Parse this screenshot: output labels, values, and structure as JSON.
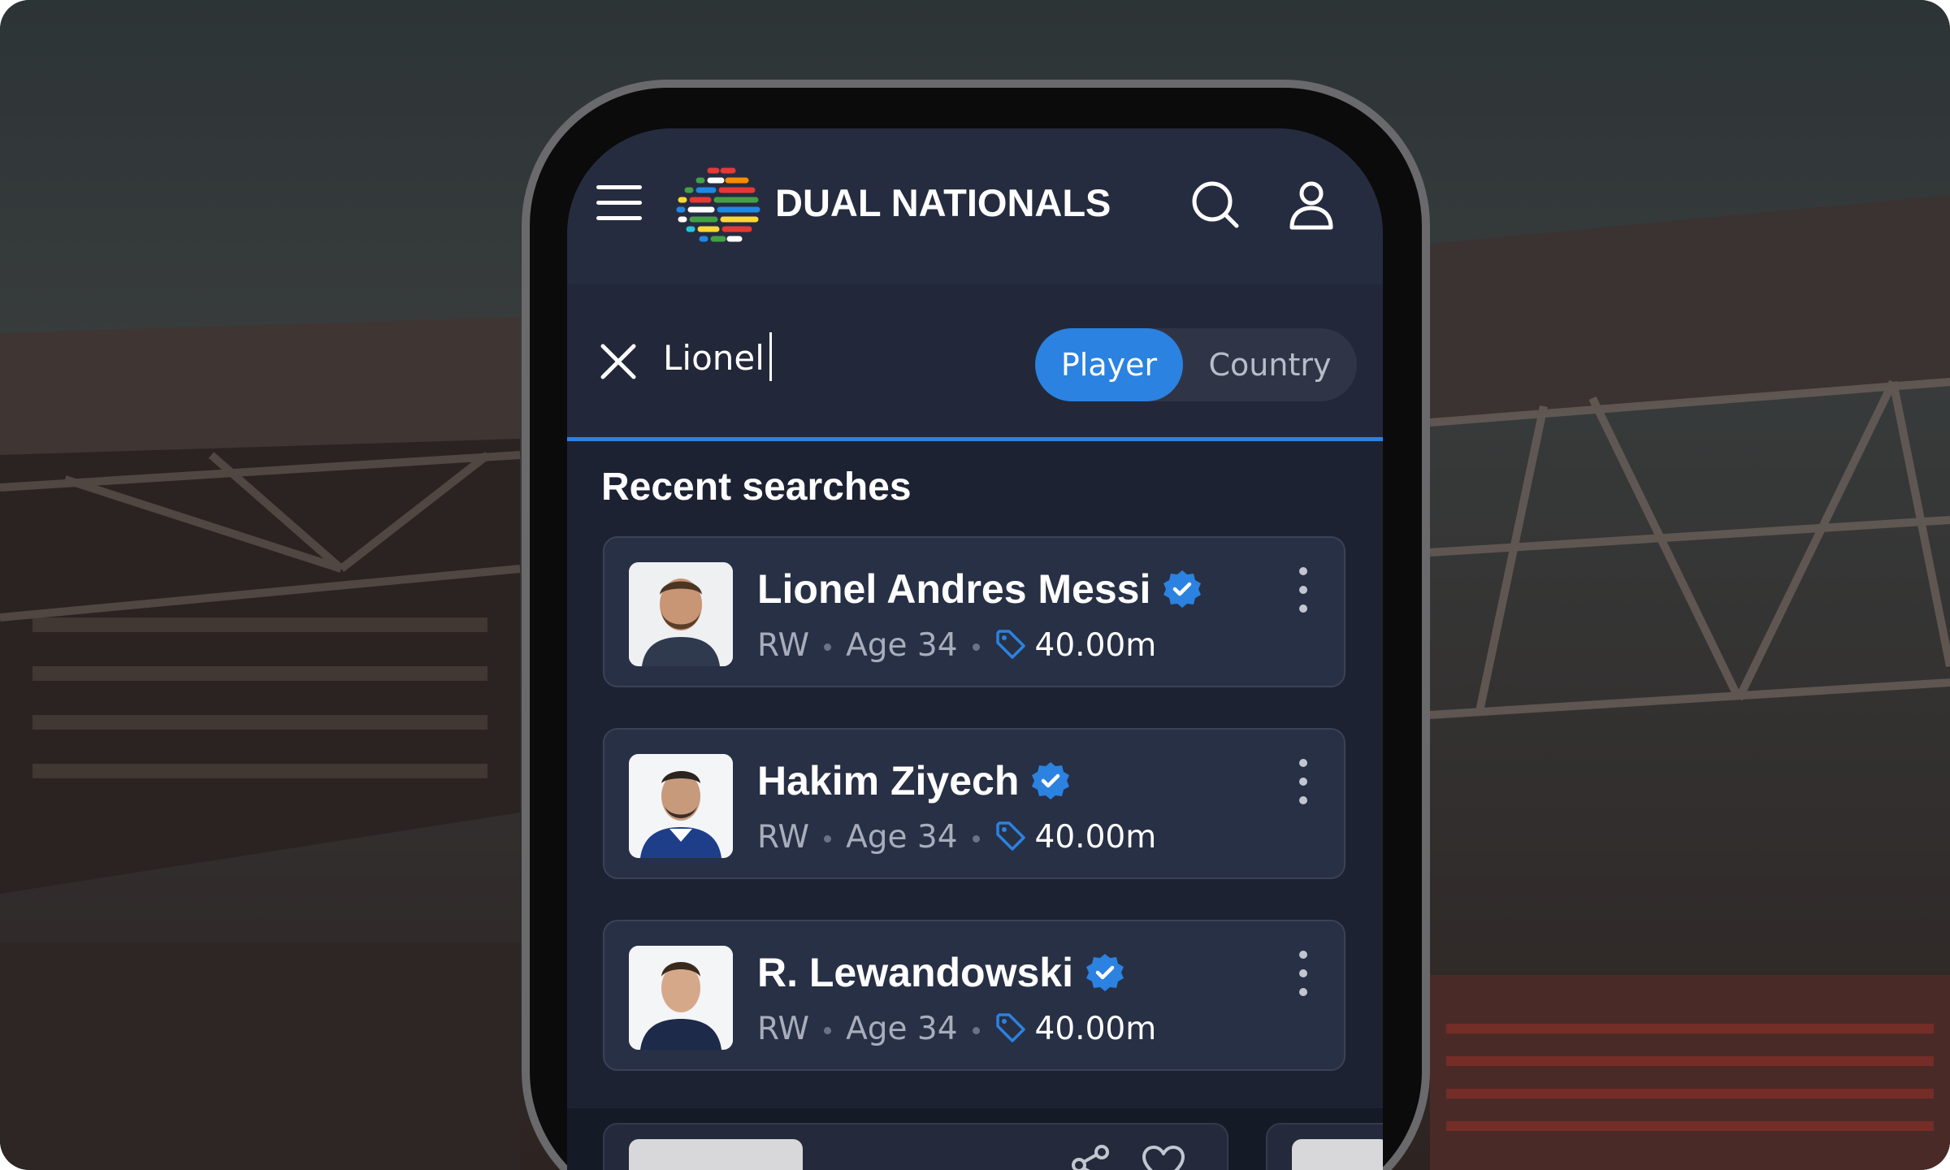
{
  "app": {
    "brand": "DUAL NATIONALS",
    "accent_color": "#2b82e0",
    "icons": {
      "menu": "hamburger-icon",
      "search": "search-icon",
      "account": "user-icon",
      "close": "close-icon",
      "verified": "verified-badge-icon",
      "price": "price-tag-icon",
      "more": "more-vertical-icon",
      "share": "share-icon",
      "favorite": "heart-icon"
    }
  },
  "search": {
    "query": "Lionel",
    "toggle": {
      "active": "Player",
      "inactive": "Country"
    }
  },
  "recent": {
    "title": "Recent searches",
    "items": [
      {
        "name": "Lionel Andres Messi",
        "position": "RW",
        "age": "Age 34",
        "value": "40.00m",
        "verified": true
      },
      {
        "name": "Hakim Ziyech",
        "position": "RW",
        "age": "Age 34",
        "value": "40.00m",
        "verified": true
      },
      {
        "name": "R. Lewandowski",
        "position": "RW",
        "age": "Age 34",
        "value": "40.00m",
        "verified": true
      }
    ]
  }
}
